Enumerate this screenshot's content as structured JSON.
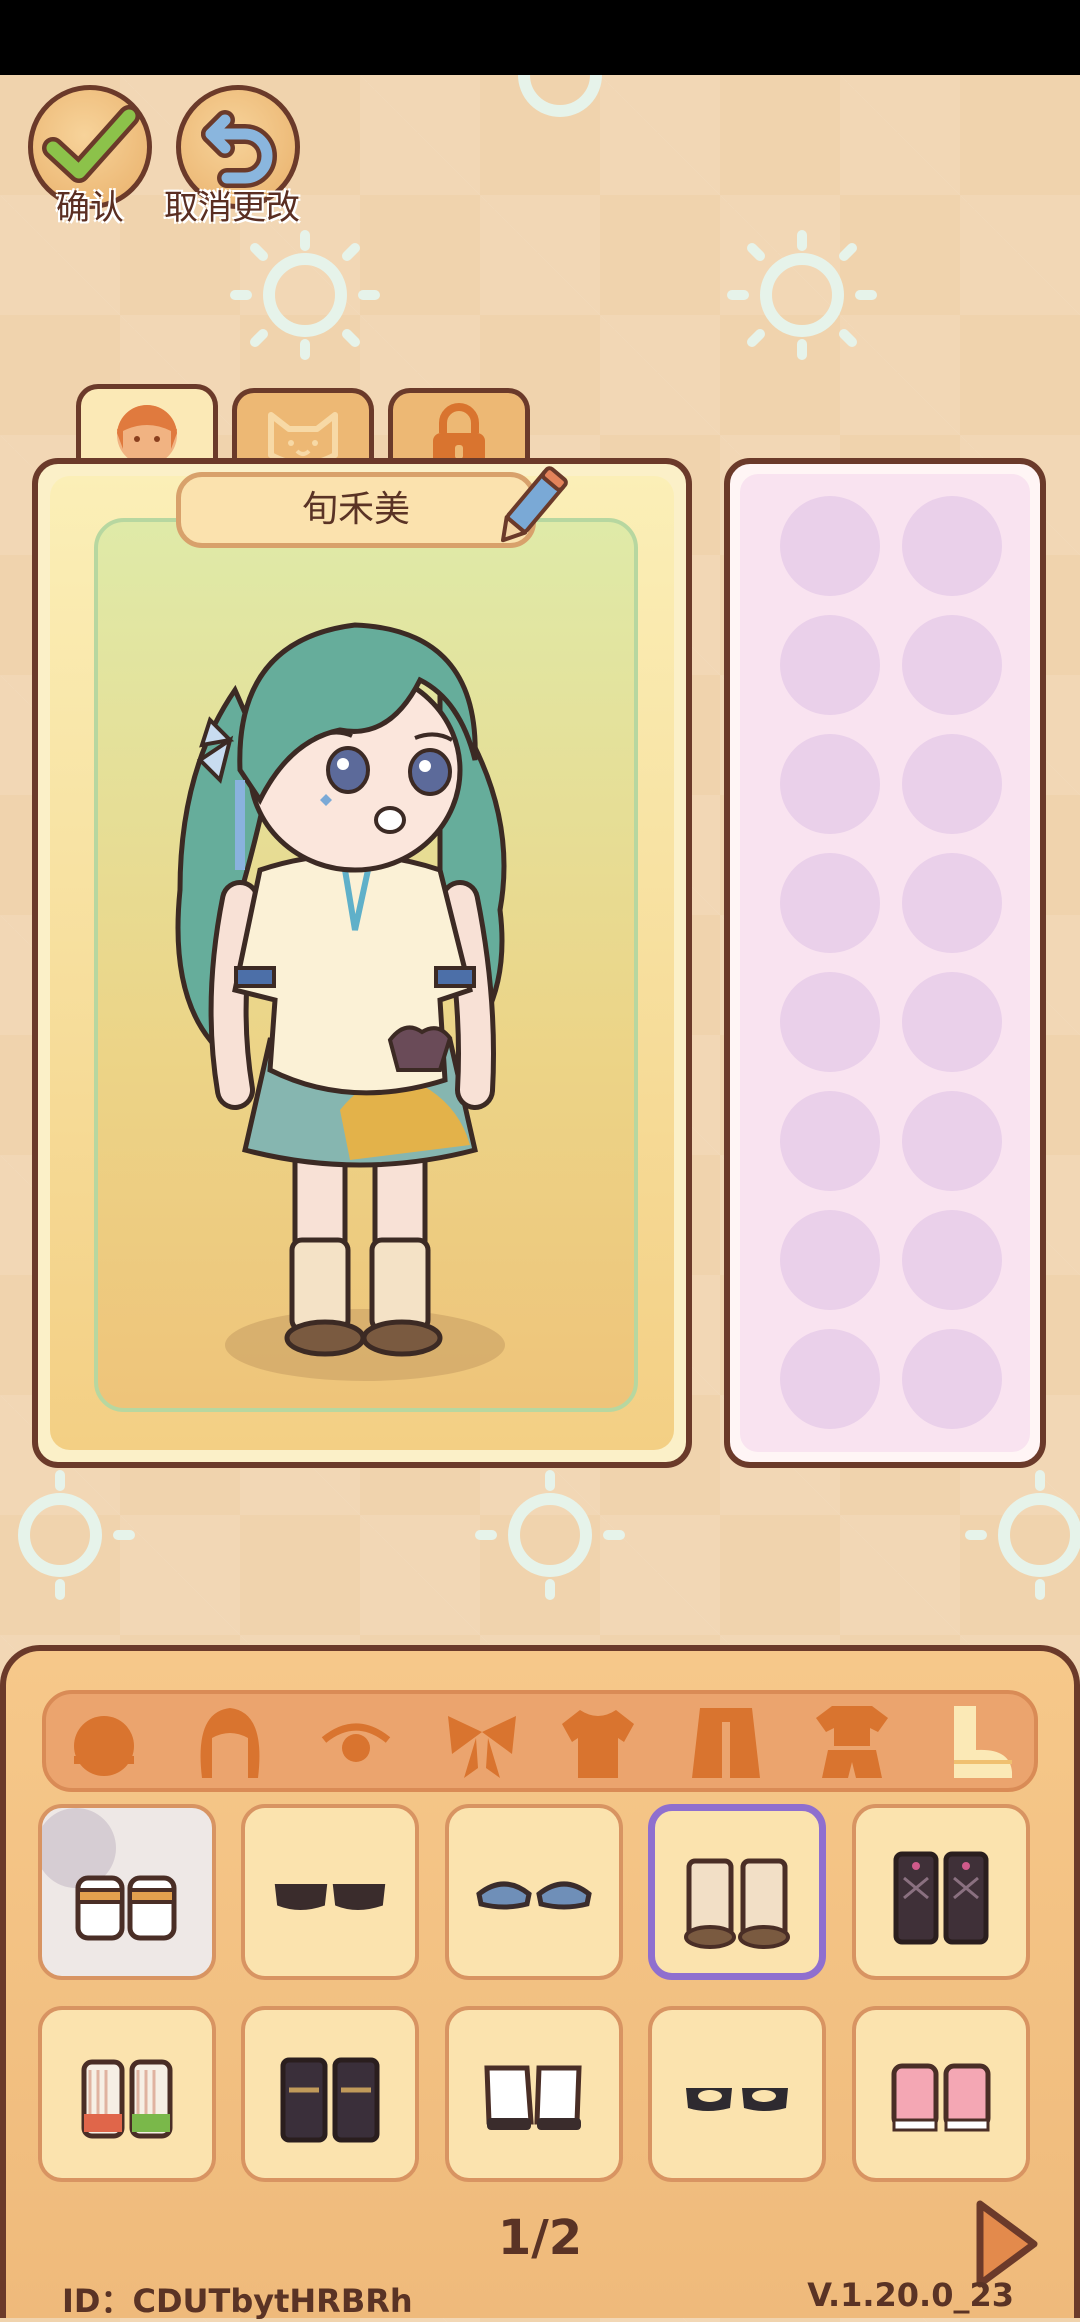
{
  "top_actions": {
    "confirm_label": "确认",
    "cancel_label": "取消更改"
  },
  "tabs": [
    {
      "name": "character",
      "icon": "girl-face-icon",
      "active": true
    },
    {
      "name": "pet",
      "icon": "cat-face-icon",
      "active": false
    },
    {
      "name": "locked",
      "icon": "lock-icon",
      "active": false
    }
  ],
  "character": {
    "name": "旬禾美"
  },
  "categories": [
    {
      "icon": "head-icon"
    },
    {
      "icon": "hair-icon"
    },
    {
      "icon": "eye-icon"
    },
    {
      "icon": "bow-icon"
    },
    {
      "icon": "shirt-icon"
    },
    {
      "icon": "coat-icon"
    },
    {
      "icon": "outfit-icon"
    },
    {
      "icon": "shoes-icon",
      "active": true
    }
  ],
  "footer": {
    "page": "1/2",
    "id": "ID：CDUTbytHRBRh",
    "version": "V.1.20.0_23"
  },
  "colors": {
    "selection": "#8f6fcf",
    "outline": "#6b3a2a"
  }
}
